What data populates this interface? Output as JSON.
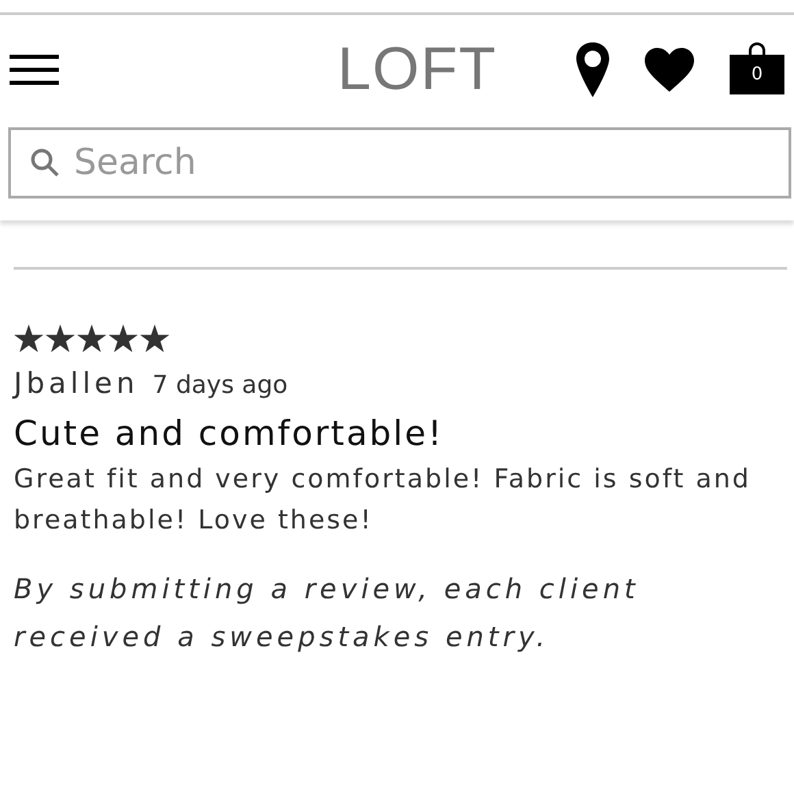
{
  "header": {
    "logo": "LOFT",
    "cart_count": "0"
  },
  "search": {
    "placeholder": "Search"
  },
  "review": {
    "stars": 5,
    "author": "Jballen",
    "date": "7 days ago",
    "title": "Cute and comfortable!",
    "body": "Great fit and very comfortable! Fabric is soft and breathable! Love these!",
    "disclaimer": "By submitting a review, each client received a sweepstakes entry."
  }
}
